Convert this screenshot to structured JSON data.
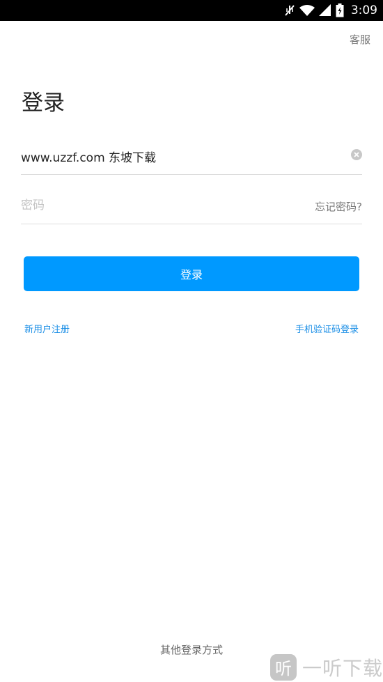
{
  "status_bar": {
    "time": "3:09",
    "icons": [
      "mute-icon",
      "wifi-icon",
      "signal-icon",
      "battery-icon"
    ]
  },
  "header": {
    "service_label": "客服"
  },
  "login": {
    "title": "登录",
    "username_value": "www.uzzf.com 东坡下载",
    "password_placeholder": "密码",
    "forgot_password": "忘记密码?",
    "submit_label": "登录",
    "register_label": "新用户注册",
    "sms_login_label": "手机验证码登录",
    "other_methods_label": "其他登录方式"
  },
  "watermark": {
    "logo_char": "听",
    "text": "一听下载"
  },
  "colors": {
    "accent": "#0099ff",
    "link": "#1a8ee6",
    "status_bar_bg": "#000000"
  }
}
